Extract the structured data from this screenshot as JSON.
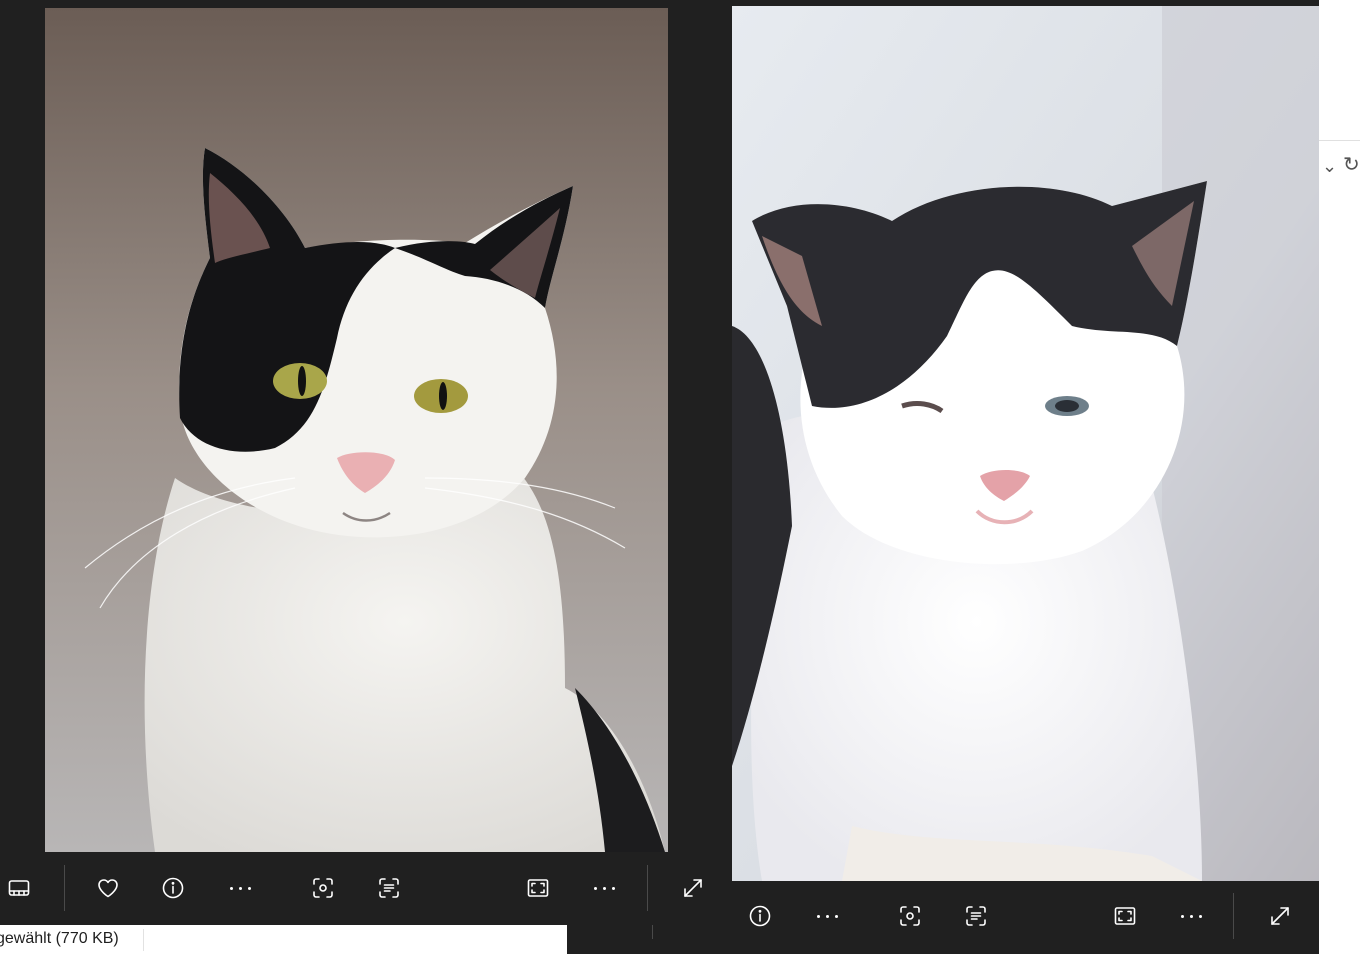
{
  "front_viewer": {
    "toolbar": {
      "filmstrip_icon": "filmstrip-icon",
      "favorite_icon": "heart-icon",
      "info_icon": "info-icon",
      "more_icon": "more-dots-icon",
      "visual_search_icon": "visual-lookup-icon",
      "text_scan_icon": "text-scan-icon",
      "fit_icon": "fit-to-window-icon",
      "more2_icon": "more-dots-icon",
      "fullscreen_icon": "expand-icon"
    }
  },
  "back_viewer": {
    "toolbar": {
      "info_icon": "info-icon",
      "more_icon": "more-dots-icon",
      "visual_search_icon": "visual-lookup-icon",
      "text_scan_icon": "text-scan-icon",
      "fit_icon": "fit-to-window-icon",
      "more2_icon": "more-dots-icon",
      "fullscreen_icon": "expand-icon"
    }
  },
  "status_bar": {
    "selection_text": "gewählt (770 KB)"
  },
  "browser": {
    "dropdown_icon": "chevron-down-icon",
    "reload_icon": "reload-icon"
  }
}
